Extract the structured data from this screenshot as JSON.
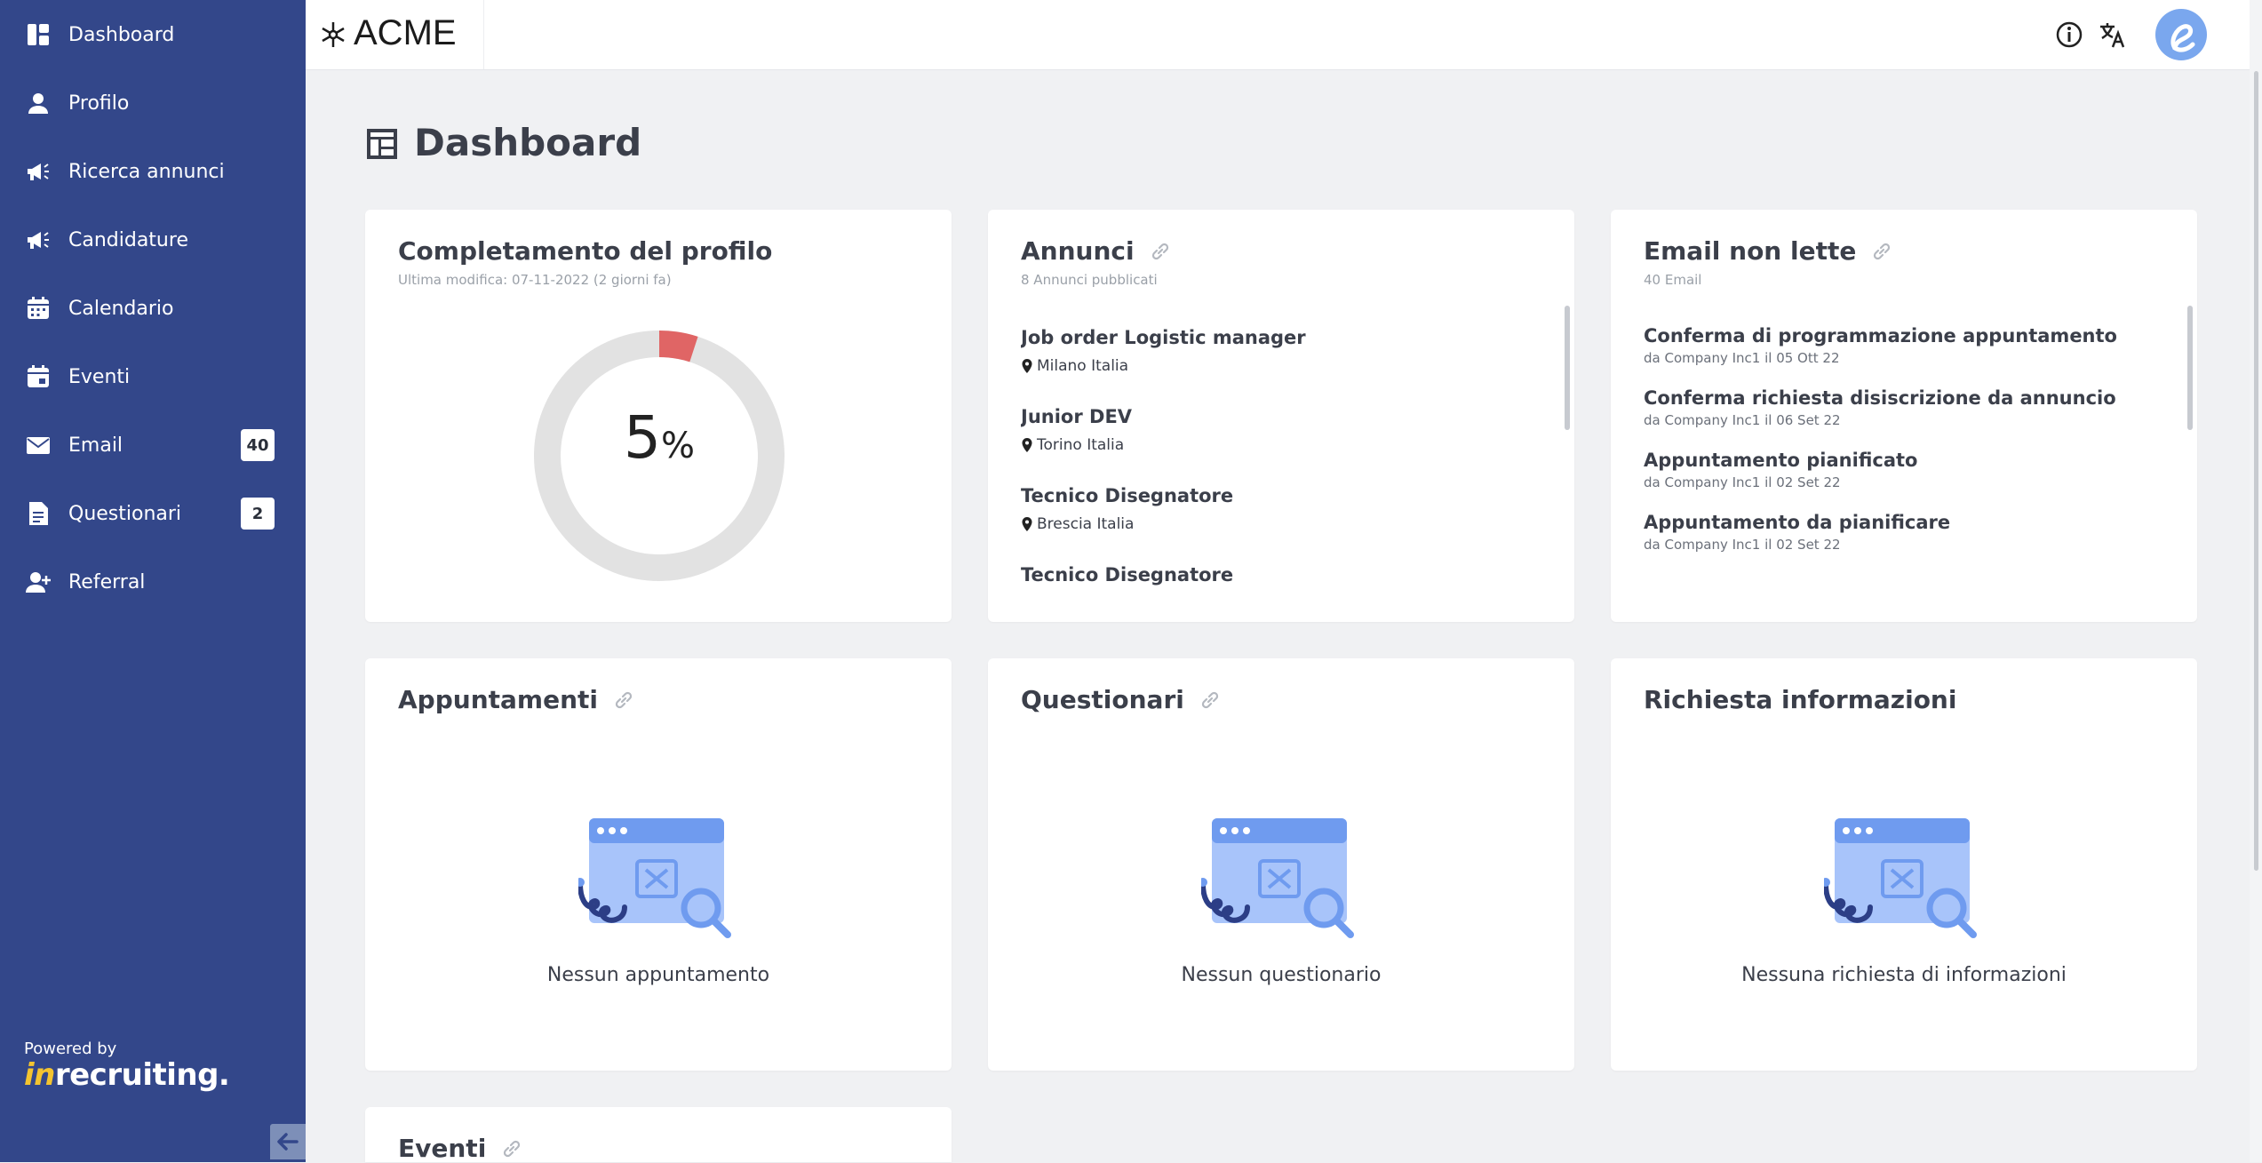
{
  "sidebar": {
    "items": [
      {
        "label": "Dashboard",
        "icon": "dashboard-icon"
      },
      {
        "label": "Profilo",
        "icon": "user-icon"
      },
      {
        "label": "Ricerca annunci",
        "icon": "megaphone-icon"
      },
      {
        "label": "Candidature",
        "icon": "megaphone-icon"
      },
      {
        "label": "Calendario",
        "icon": "calendar-icon"
      },
      {
        "label": "Eventi",
        "icon": "event-icon"
      },
      {
        "label": "Email",
        "icon": "mail-icon",
        "badge": "40"
      },
      {
        "label": "Questionari",
        "icon": "document-icon",
        "badge": "2"
      },
      {
        "label": "Referral",
        "icon": "user-add-icon"
      }
    ],
    "powered_by": "Powered by",
    "brand_prefix": "in",
    "brand_name": "recruiting."
  },
  "topbar": {
    "logo_text": "ACME",
    "icons": [
      "info-icon",
      "translate-icon",
      "avatar"
    ]
  },
  "page": {
    "title": "Dashboard"
  },
  "cards": {
    "profile": {
      "title": "Completamento del profilo",
      "subtitle": "Ultima modifica: 07-11-2022 (2 giorni fa)",
      "percent": 5,
      "value_text": "5",
      "percent_symbol": "%"
    },
    "ads": {
      "title": "Annunci",
      "subtitle": "8 Annunci pubblicati",
      "jobs": [
        {
          "title": "Job order Logistic manager",
          "location": "Milano Italia"
        },
        {
          "title": "Junior DEV",
          "location": "Torino Italia"
        },
        {
          "title": "Tecnico Disegnatore",
          "location": "Brescia Italia"
        },
        {
          "title": "Tecnico Disegnatore",
          "location": ""
        }
      ]
    },
    "emails": {
      "title": "Email non lette",
      "subtitle": "40 Email",
      "items": [
        {
          "subject": "Conferma di programmazione appuntamento",
          "from": "da Company Inc1 il 05 Ott 22"
        },
        {
          "subject": "Conferma richiesta disiscrizione da annuncio",
          "from": "da Company Inc1 il 06 Set 22"
        },
        {
          "subject": "Appuntamento pianificato",
          "from": "da Company Inc1 il 02 Set 22"
        },
        {
          "subject": "Appuntamento da pianificare",
          "from": "da Company Inc1 il 02 Set 22"
        }
      ]
    },
    "appointments": {
      "title": "Appuntamenti",
      "empty": "Nessun appuntamento"
    },
    "surveys": {
      "title": "Questionari",
      "empty": "Nessun questionario"
    },
    "info_requests": {
      "title": "Richiesta informazioni",
      "empty": "Nessuna richiesta di informazioni"
    },
    "events": {
      "title": "Eventi"
    }
  },
  "colors": {
    "sidebar": "#33478a",
    "accent_red": "#e06565",
    "donut_track": "#e2e2e2",
    "illustration_blue": "#6f9bef",
    "illustration_dark": "#2c3e86"
  }
}
